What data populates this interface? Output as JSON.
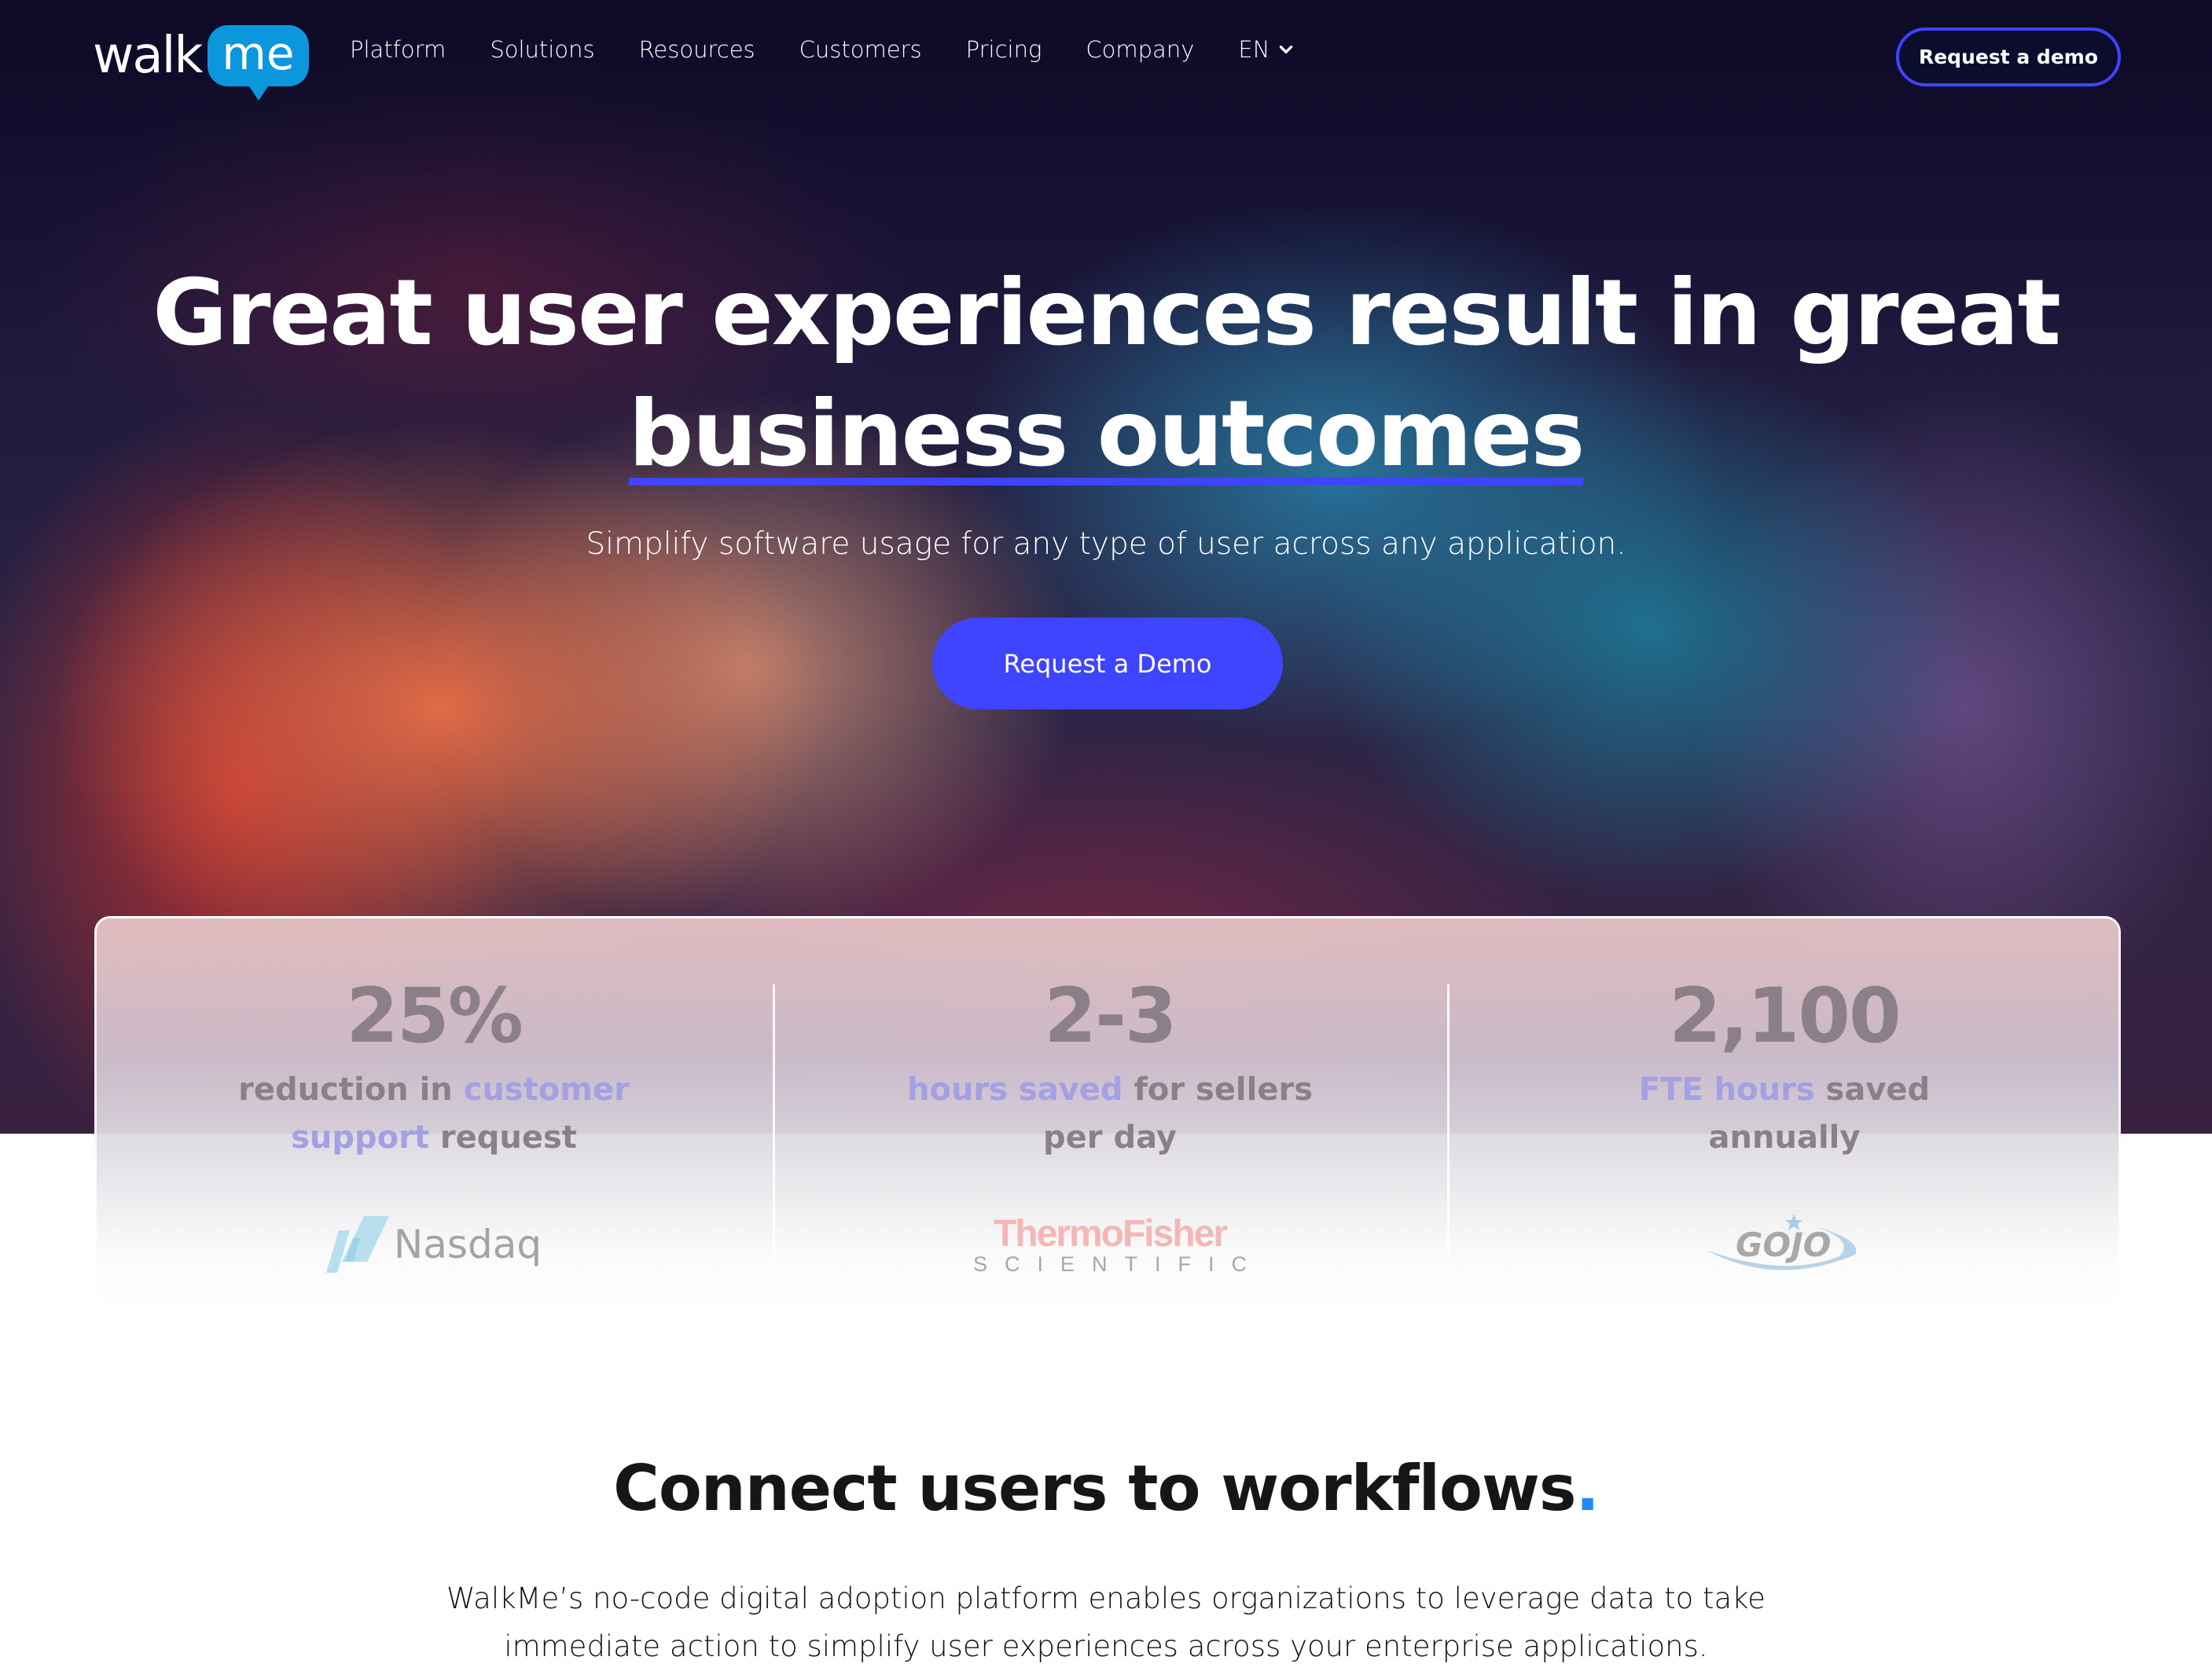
{
  "nav": {
    "logo_word": "walk",
    "logo_badge": "me",
    "links": [
      "Platform",
      "Solutions",
      "Resources",
      "Customers",
      "Pricing",
      "Company"
    ],
    "language": "EN",
    "cta": "Request a demo"
  },
  "hero": {
    "headline_line1": "Great user experiences result in great",
    "headline_line2": "business outcomes",
    "subheadline": "Simplify software usage for any type of user across any application.",
    "cta": "Request a Demo"
  },
  "stats": [
    {
      "number": "25%",
      "desc_parts": [
        {
          "text": "reduction in ",
          "hl": false
        },
        {
          "text": "customer support",
          "hl": true
        },
        {
          "text": " request",
          "hl": false
        }
      ],
      "logo": "Nasdaq"
    },
    {
      "number": "2-3",
      "desc_parts": [
        {
          "text": "hours saved",
          "hl": true
        },
        {
          "text": " for sellers per day",
          "hl": false
        }
      ],
      "logo_top": "ThermoFisher",
      "logo_bottom": "SCIENTIFIC"
    },
    {
      "number": "2,100",
      "desc_parts": [
        {
          "text": "FTE hours",
          "hl": true
        },
        {
          "text": " saved annually",
          "hl": false
        }
      ],
      "logo": "GOJO"
    }
  ],
  "section": {
    "title": "Connect users to workflows",
    "title_dot": ".",
    "body": "WalkMe’s no-code digital adoption platform enables organizations to leverage data to take immediate action to simplify user experiences across your enterprise applications."
  },
  "colors": {
    "accent": "#3f44ff",
    "logo_blue": "#0b97dc",
    "stat_highlight": "#a3a0e3",
    "stat_text": "#8c8088",
    "title_dot": "#1a8cff"
  }
}
